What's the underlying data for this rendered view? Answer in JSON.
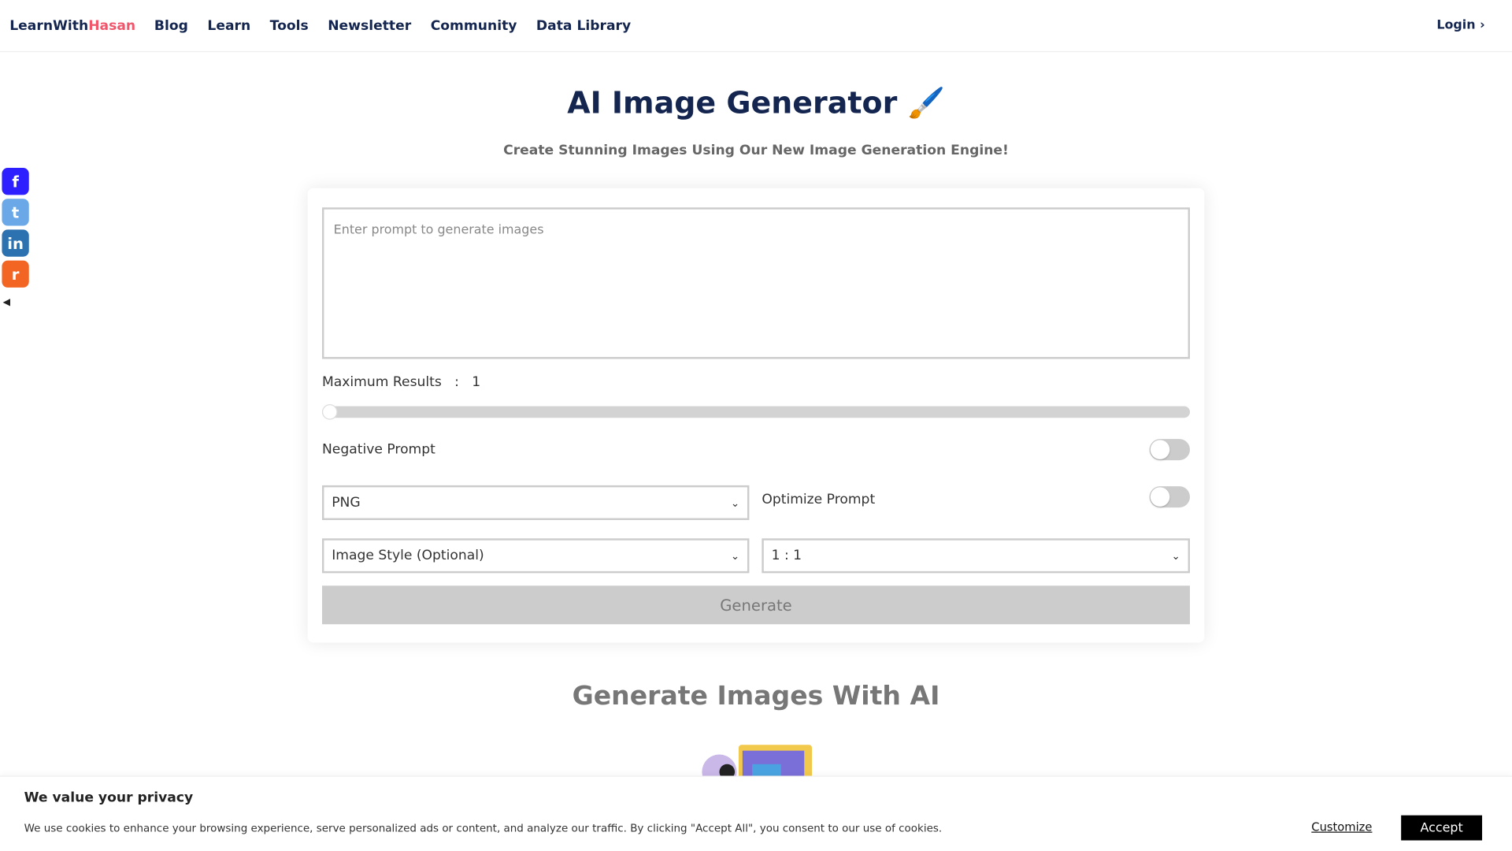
{
  "nav": {
    "logo_a": "LearnWith",
    "logo_b": "Hasan",
    "links": [
      "Blog",
      "Learn",
      "Tools",
      "Newsletter",
      "Community",
      "Data Library"
    ],
    "login": "Login ›"
  },
  "social": [
    {
      "icon": "facebook-icon",
      "glyph": "f",
      "color": "#2d1fff"
    },
    {
      "icon": "twitter-icon",
      "glyph": "t",
      "color": "#6aa8e8"
    },
    {
      "icon": "linkedin-icon",
      "glyph": "in",
      "color": "#2d72b0"
    },
    {
      "icon": "reddit-icon",
      "glyph": "r",
      "color": "#f26522"
    }
  ],
  "hero": {
    "title": "AI Image Generator 🖌️",
    "subtitle": "Create Stunning Images Using Our New Image Generation Engine!"
  },
  "form": {
    "prompt_placeholder": "Enter prompt to generate images",
    "max_results_label": "Maximum Results",
    "max_results_sep": ":",
    "max_results_value": "1",
    "slider_fraction": 0,
    "negative_prompt_label": "Negative Prompt",
    "negative_prompt_on": false,
    "format_value": "PNG",
    "optimize_prompt_label": "Optimize Prompt",
    "optimize_prompt_on": false,
    "style_value": "Image Style (Optional)",
    "ratio_value": "1 : 1",
    "generate_label": "Generate"
  },
  "section": {
    "title": "Generate Images With AI"
  },
  "cookie": {
    "title": "We value your privacy",
    "text": "We use cookies to enhance your browsing experience, serve personalized ads or content, and analyze our traffic. By clicking \"Accept All\", you consent to our use of cookies.",
    "customize": "Customize",
    "accept": "Accept"
  }
}
